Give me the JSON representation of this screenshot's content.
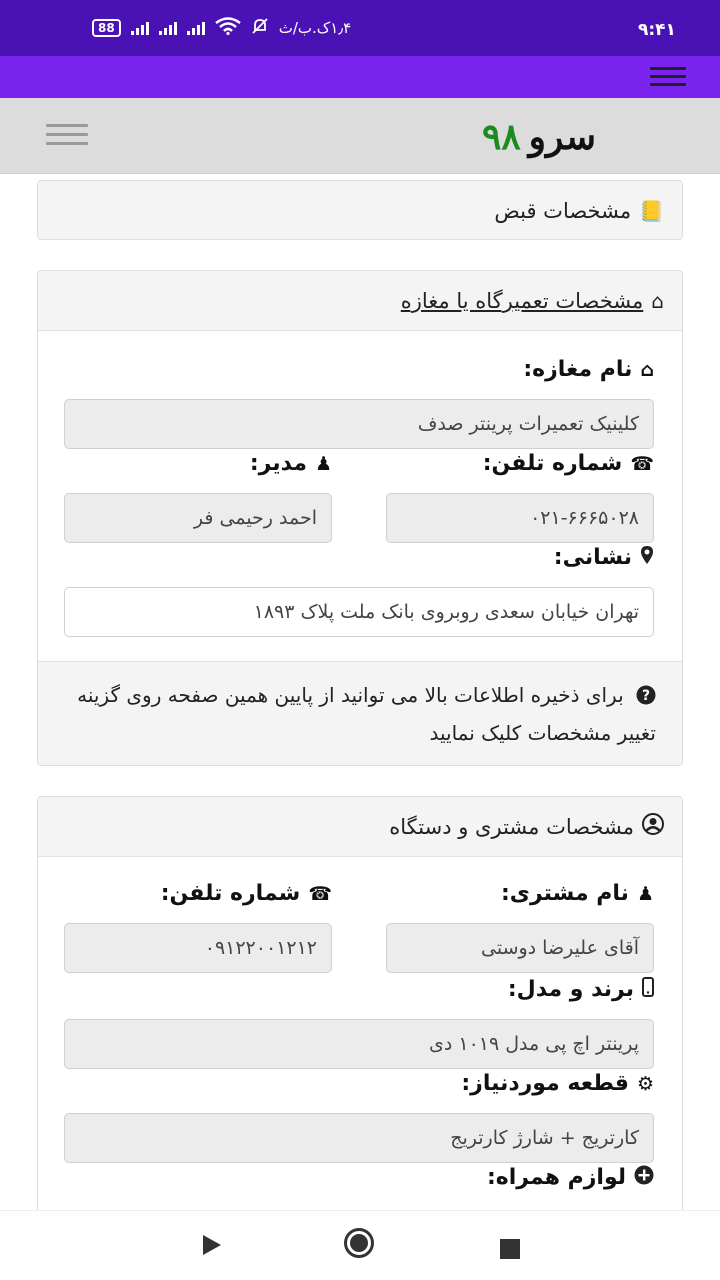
{
  "status_bar": {
    "time": "۹:۴۱",
    "speed": "۱٫۴ک.ب/ث",
    "battery": "88",
    "icons": [
      "mute-icon",
      "wifi-icon",
      "signal-icon",
      "signal-icon",
      "signal-icon"
    ]
  },
  "app_bar": {
    "menu_icon": "menu-icon"
  },
  "header": {
    "brand_word": "سرو",
    "brand_number": "۹۸",
    "toggle_icon": "menu-icon"
  },
  "receipt_card": {
    "title": "مشخصات قبض",
    "icon": "book-icon"
  },
  "shop_card": {
    "title": "مشخصات تعمیرگاه یا مغازه",
    "shop_name_label": "نام مغازه:",
    "shop_name_value": "کلینیک تعمیرات پرینتر صدف",
    "phone_label": "شماره تلفن:",
    "phone_value": "۰۲۱-۶۶۶۵۰۲۸",
    "manager_label": "مدیر:",
    "manager_value": "احمد رحیمی فر",
    "address_label": "نشانی:",
    "address_value": "تهران خیابان سعدی روبروی بانک ملت پلاک ۱۸۹۳",
    "note": "برای ذخیره اطلاعات بالا می توانید از پایین همین صفحه روی گزینه تغییر مشخصات کلیک نمایید"
  },
  "customer_card": {
    "title": "مشخصات مشتری و دستگاه",
    "customer_name_label": "نام مشتری:",
    "customer_name_value": "آقای علیرضا دوستی",
    "phone_label": "شماره تلفن:",
    "phone_value": "۰۹۱۲۲۰۰۱۲۱۲",
    "brand_label": "برند و مدل:",
    "brand_value": "پرینتر اچ پی مدل ۱۰۱۹ دی",
    "part_label": "قطعه موردنیاز:",
    "part_value": "کارتریج + شارژ کارتریج",
    "accessories_label": "لوازم همراه:"
  },
  "colors": {
    "status_bar": "#4a12b4",
    "app_bar": "#7a23ee",
    "brand_number": "#1c8a1c"
  }
}
